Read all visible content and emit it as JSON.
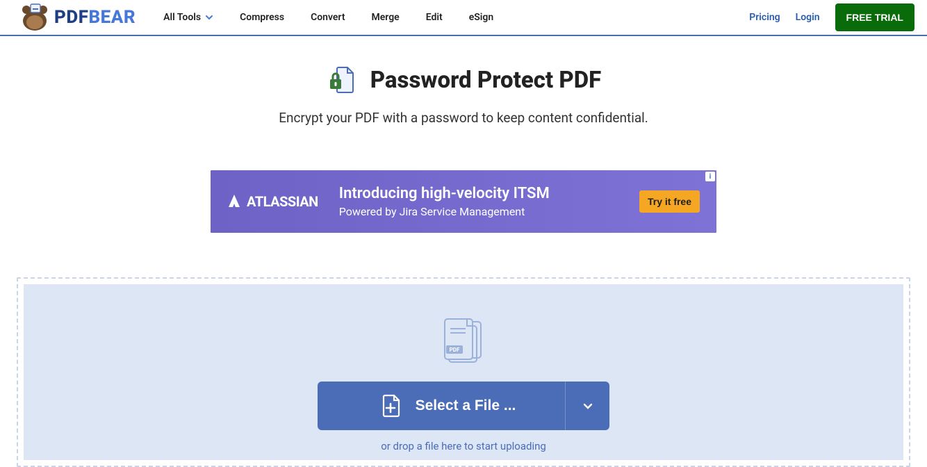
{
  "brand": {
    "left": "PDF",
    "right": "BEAR"
  },
  "nav": {
    "all_tools": "All Tools",
    "compress": "Compress",
    "convert": "Convert",
    "merge": "Merge",
    "edit": "Edit",
    "esign": "eSign"
  },
  "right_nav": {
    "pricing": "Pricing",
    "login": "Login",
    "trial": "FREE TRIAL"
  },
  "hero": {
    "title": "Password Protect PDF",
    "subtitle": "Encrypt your PDF with a password to keep content confidential."
  },
  "ad": {
    "brand": "ATLASSIAN",
    "headline": "Introducing high-velocity ITSM",
    "subline": "Powered by Jira Service Management",
    "cta": "Try it free",
    "info": "i"
  },
  "dropzone": {
    "select_label": "Select a File ...",
    "hint": "or drop a file here to start uploading"
  },
  "colors": {
    "accent": "#4b6cb7",
    "trial_bg": "#0a6b0a",
    "ad_bg_start": "#6e62c6",
    "ad_cta": "#f5a623"
  }
}
